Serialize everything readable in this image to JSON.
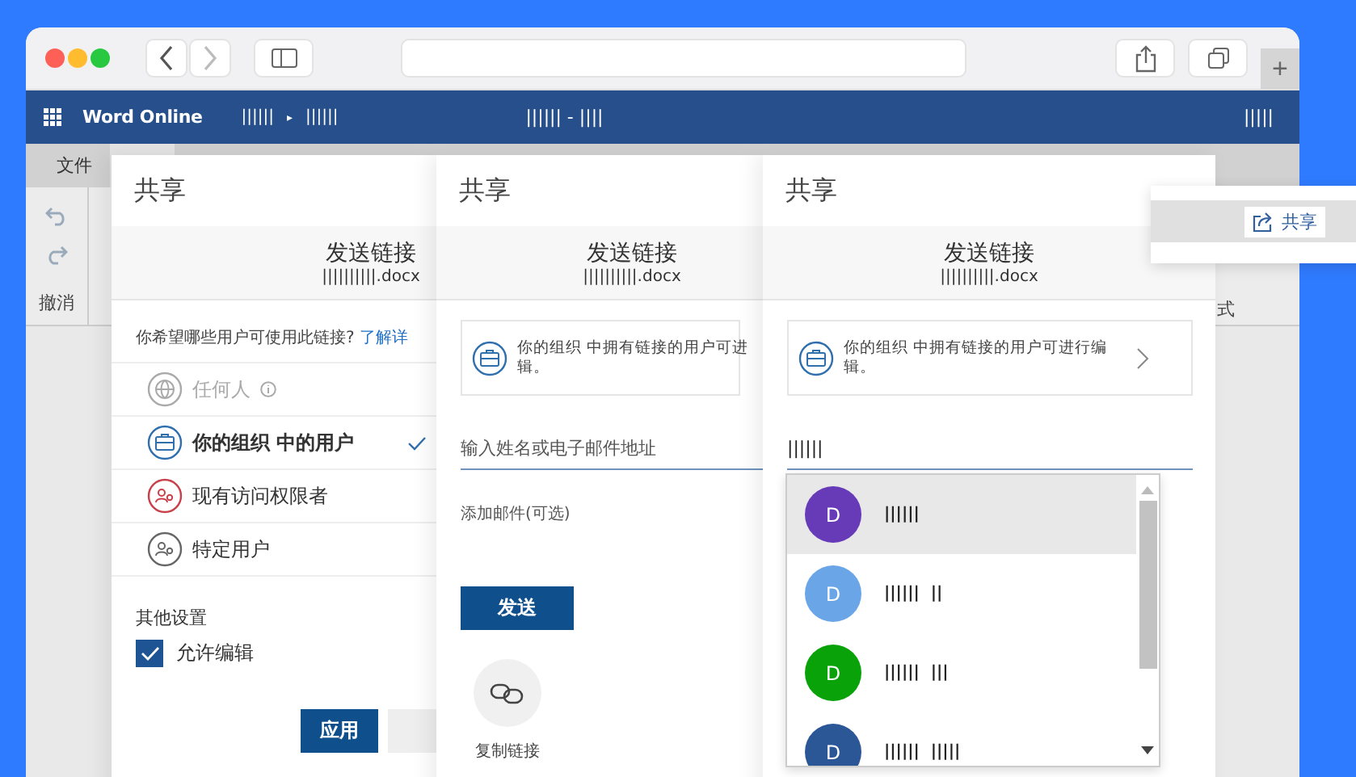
{
  "app_bar": {
    "app_name": "Word Online",
    "breadcrumb": [
      "||||||",
      "||||||"
    ],
    "breadcrumb_separator": "▸",
    "doc_title": "|||||| - ||||",
    "user": "|||||"
  },
  "browser": {
    "new_tab": "+"
  },
  "ribbon": {
    "tabs": [
      {
        "label": "文件",
        "selected": false
      },
      {
        "selected": true
      }
    ],
    "undo_label": "撤消",
    "style_label": "式"
  },
  "share_popup": {
    "button": "共享"
  },
  "panels": [
    {
      "title": "共享",
      "subtitle": "发送链接",
      "file": "||||||||||.docx",
      "kind": "link_settings",
      "question": "你希望哪些用户可使用此链接?",
      "learn_more": "了解详",
      "options": [
        {
          "label": "任何人",
          "disabled": true,
          "selected": false,
          "info": true
        },
        {
          "label": "你的组织 中的用户",
          "disabled": false,
          "selected": true,
          "info": false
        },
        {
          "label": "现有访问权限者",
          "disabled": false,
          "selected": false,
          "info": false
        },
        {
          "label": "特定用户",
          "disabled": false,
          "selected": false,
          "info": false
        }
      ],
      "other_settings": "其他设置",
      "allow_edit": {
        "label": "允许编辑",
        "checked": true
      },
      "apply": "应用"
    },
    {
      "title": "共享",
      "subtitle": "发送链接",
      "file": "||||||||||.docx",
      "kind": "send",
      "notice_lines": [
        "你的组织 中拥有链接的用户可进",
        "辑。"
      ],
      "recipient": {
        "placeholder": "输入姓名或电子邮件地址"
      },
      "message_placeholder": "添加邮件(可选)",
      "send": "发送",
      "copy_link": "复制链接"
    },
    {
      "title": "共享",
      "subtitle": "发送链接",
      "file": "||||||||||.docx",
      "kind": "suggest",
      "notice": "你的组织 中拥有链接的用户可进行编辑。",
      "recipient": {
        "value": "||||||"
      },
      "suggestions": [
        {
          "initial": "D",
          "name": "||||||",
          "color": "#673ab7",
          "selected": true
        },
        {
          "initial": "D",
          "name": "||||||  ||",
          "color": "#6aa5e8",
          "selected": false
        },
        {
          "initial": "D",
          "name": "||||||  |||",
          "color": "#09a309",
          "selected": false
        },
        {
          "initial": "D",
          "name": "||||||  |||||",
          "color": "#2b5797",
          "selected": false
        }
      ]
    }
  ]
}
